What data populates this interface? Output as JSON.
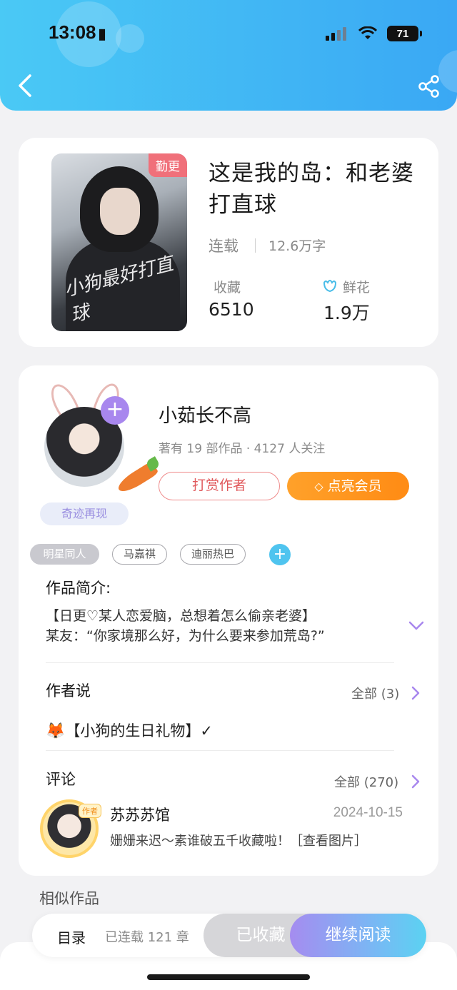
{
  "status_bar": {
    "time": "13:08",
    "battery": "71"
  },
  "book": {
    "cover_badge": "勤更",
    "cover_script": "小狗最好打直球",
    "title": "这是我的岛：和老婆打直球",
    "status": "连载",
    "word_count": "12.6万字",
    "favorites_label": "收藏",
    "favorites_value": "6510",
    "flowers_label": "鲜花",
    "flowers_value": "1.9万"
  },
  "author": {
    "name": "小茹长不高",
    "meta": "著有 19 部作品 · 4127 人关注",
    "miracle_tag": "奇迹再现",
    "tip_button": "打赏作者",
    "vip_button": "点亮会员",
    "tags": [
      "明星同人",
      "马嘉祺",
      "迪丽热巴"
    ]
  },
  "intro": {
    "title": "作品简介:",
    "line1": "【日更♡某人恋爱脑，总想着怎么偷亲老婆】",
    "line2": "某友：“你家境那么好，为什么要来参加荒岛?”"
  },
  "author_says": {
    "title": "作者说",
    "all_link": "全部 (3)",
    "text": "【小狗的生日礼物】✓"
  },
  "comments": {
    "title": "评论",
    "all_link": "全部 (270)",
    "author_badge": "作者",
    "commenter": "苏苏苏馆",
    "date": "2024-10-15",
    "text": "姗姗来迟～素谁破五千收藏啦！［查看图片］"
  },
  "similar_title": "相似作品",
  "bottom_bar": {
    "toc": "目录",
    "chapters": "已连载 121 章",
    "fav_button": "已收藏",
    "read_button": "继续阅读"
  },
  "colors": {
    "header_start": "#4ac9f5",
    "header_end": "#3aa8f4",
    "vip_orange": "#ff8b14",
    "tip_red": "#e0585b",
    "accent_purple": "#a887ee"
  }
}
